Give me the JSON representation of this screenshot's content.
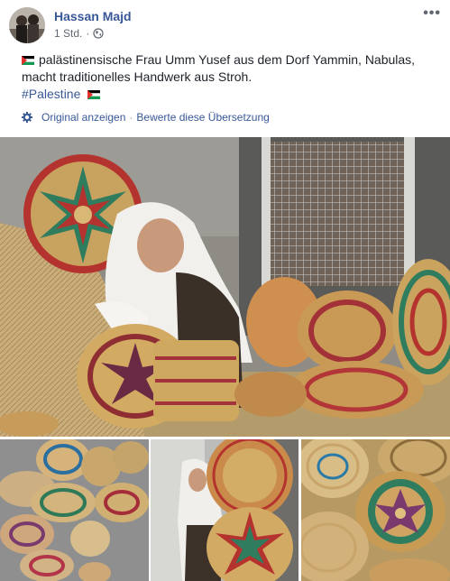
{
  "post": {
    "author": "Hassan Majd",
    "time": "1 Std.",
    "separator": "·",
    "more_label": "•••",
    "text_line1": "palästinensische Frau Umm Yusef aus dem Dorf Yammin, Nabulas,",
    "text_line2": "macht traditionelles Handwerk aus Stroh.",
    "hashtag": "#Palestine"
  },
  "translation": {
    "show_original": "Original anzeigen",
    "separator": "·",
    "rate": "Bewerte diese Übersetzung"
  },
  "photos": {
    "main": "woman-weaving-straw-baskets",
    "thumb1": "stack-of-patterned-baskets",
    "thumb2": "woman-holding-straw-plate",
    "thumb3": "coiled-straw-baskets"
  },
  "icons": {
    "globe": "globe-icon",
    "gear": "gear-icon",
    "flag": "palestine-flag-icon"
  },
  "colors": {
    "link": "#385898",
    "meta": "#616770",
    "text": "#1d2129"
  }
}
